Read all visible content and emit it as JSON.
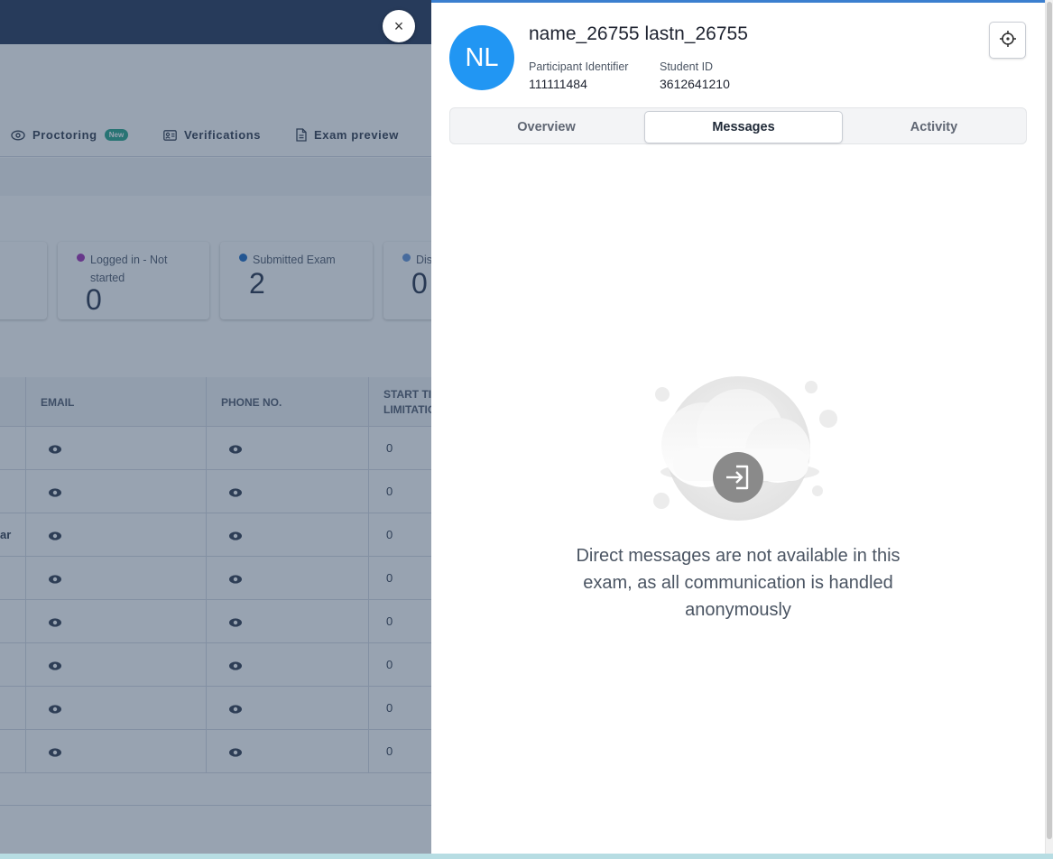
{
  "background_app": {
    "nav_tabs": [
      {
        "label": "Proctoring",
        "badge": "New",
        "icon": "eye-icon"
      },
      {
        "label": "Verifications",
        "icon": "id-card-icon"
      },
      {
        "label": "Exam preview",
        "icon": "document-icon"
      }
    ],
    "stat_cards": [
      {
        "label": "Logged in - Not started",
        "value": "0",
        "dot_color": "#9c27b0"
      },
      {
        "label": "Submitted Exam",
        "value": "2",
        "dot_color": "#1565c0"
      },
      {
        "label": "Dis",
        "value": "0",
        "dot_color": "#5c8fd6"
      }
    ],
    "table": {
      "columns": [
        "EMAIL",
        "PHONE NO.",
        "START TIME LIMITATION"
      ],
      "rows": [
        {
          "prefix": "",
          "email": "eye-icon",
          "phone": "eye-icon",
          "start": "0"
        },
        {
          "prefix": "",
          "email": "eye-icon",
          "phone": "eye-icon",
          "start": "0"
        },
        {
          "prefix": "ar",
          "email": "eye-icon",
          "phone": "eye-icon",
          "start": "0"
        },
        {
          "prefix": "",
          "email": "eye-icon",
          "phone": "eye-icon",
          "start": "0"
        },
        {
          "prefix": "",
          "email": "eye-icon",
          "phone": "eye-icon",
          "start": "0"
        },
        {
          "prefix": "",
          "email": "eye-icon",
          "phone": "eye-icon",
          "start": "0"
        },
        {
          "prefix": "",
          "email": "eye-icon",
          "phone": "eye-icon",
          "start": "0"
        },
        {
          "prefix": "",
          "email": "eye-icon",
          "phone": "eye-icon",
          "start": "0"
        }
      ]
    }
  },
  "close_button": {
    "label": "×"
  },
  "participant": {
    "initials": "NL",
    "name": "name_26755 lastn_26755",
    "identifier_label": "Participant Identifier",
    "identifier_value": "111111484",
    "student_id_label": "Student ID",
    "student_id_value": "3612641210",
    "avatar_color": "#2196f3"
  },
  "drawer_tabs": [
    {
      "label": "Overview",
      "active": false
    },
    {
      "label": "Messages",
      "active": true
    },
    {
      "label": "Activity",
      "active": false
    }
  ],
  "messages": {
    "empty_text": "Direct messages are not available in this exam, as all communication is handled anonymously",
    "illustration_icon": "sign-in-icon"
  },
  "colors": {
    "accent": "#3b7fcf",
    "topbar": "#1c2e52",
    "badge_new": "#1fa184"
  }
}
